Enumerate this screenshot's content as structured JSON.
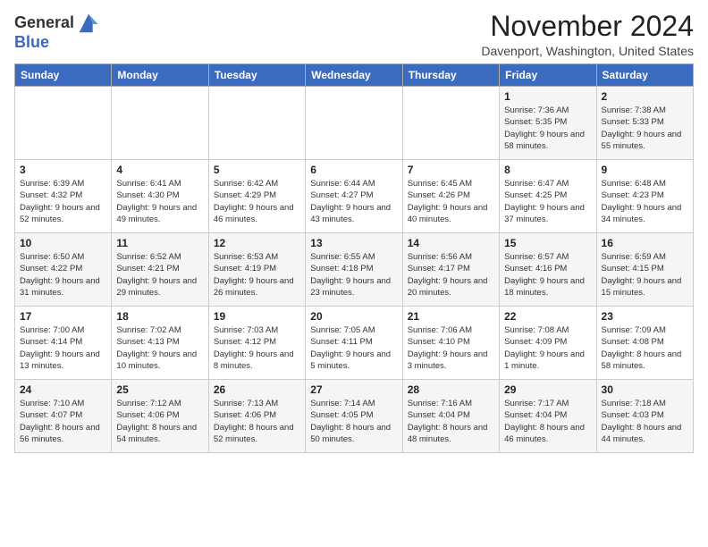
{
  "logo": {
    "line1": "General",
    "line2": "Blue"
  },
  "title": "November 2024",
  "location": "Davenport, Washington, United States",
  "days_of_week": [
    "Sunday",
    "Monday",
    "Tuesday",
    "Wednesday",
    "Thursday",
    "Friday",
    "Saturday"
  ],
  "weeks": [
    [
      {
        "day": "",
        "info": ""
      },
      {
        "day": "",
        "info": ""
      },
      {
        "day": "",
        "info": ""
      },
      {
        "day": "",
        "info": ""
      },
      {
        "day": "",
        "info": ""
      },
      {
        "day": "1",
        "info": "Sunrise: 7:36 AM\nSunset: 5:35 PM\nDaylight: 9 hours and 58 minutes."
      },
      {
        "day": "2",
        "info": "Sunrise: 7:38 AM\nSunset: 5:33 PM\nDaylight: 9 hours and 55 minutes."
      }
    ],
    [
      {
        "day": "3",
        "info": "Sunrise: 6:39 AM\nSunset: 4:32 PM\nDaylight: 9 hours and 52 minutes."
      },
      {
        "day": "4",
        "info": "Sunrise: 6:41 AM\nSunset: 4:30 PM\nDaylight: 9 hours and 49 minutes."
      },
      {
        "day": "5",
        "info": "Sunrise: 6:42 AM\nSunset: 4:29 PM\nDaylight: 9 hours and 46 minutes."
      },
      {
        "day": "6",
        "info": "Sunrise: 6:44 AM\nSunset: 4:27 PM\nDaylight: 9 hours and 43 minutes."
      },
      {
        "day": "7",
        "info": "Sunrise: 6:45 AM\nSunset: 4:26 PM\nDaylight: 9 hours and 40 minutes."
      },
      {
        "day": "8",
        "info": "Sunrise: 6:47 AM\nSunset: 4:25 PM\nDaylight: 9 hours and 37 minutes."
      },
      {
        "day": "9",
        "info": "Sunrise: 6:48 AM\nSunset: 4:23 PM\nDaylight: 9 hours and 34 minutes."
      }
    ],
    [
      {
        "day": "10",
        "info": "Sunrise: 6:50 AM\nSunset: 4:22 PM\nDaylight: 9 hours and 31 minutes."
      },
      {
        "day": "11",
        "info": "Sunrise: 6:52 AM\nSunset: 4:21 PM\nDaylight: 9 hours and 29 minutes."
      },
      {
        "day": "12",
        "info": "Sunrise: 6:53 AM\nSunset: 4:19 PM\nDaylight: 9 hours and 26 minutes."
      },
      {
        "day": "13",
        "info": "Sunrise: 6:55 AM\nSunset: 4:18 PM\nDaylight: 9 hours and 23 minutes."
      },
      {
        "day": "14",
        "info": "Sunrise: 6:56 AM\nSunset: 4:17 PM\nDaylight: 9 hours and 20 minutes."
      },
      {
        "day": "15",
        "info": "Sunrise: 6:57 AM\nSunset: 4:16 PM\nDaylight: 9 hours and 18 minutes."
      },
      {
        "day": "16",
        "info": "Sunrise: 6:59 AM\nSunset: 4:15 PM\nDaylight: 9 hours and 15 minutes."
      }
    ],
    [
      {
        "day": "17",
        "info": "Sunrise: 7:00 AM\nSunset: 4:14 PM\nDaylight: 9 hours and 13 minutes."
      },
      {
        "day": "18",
        "info": "Sunrise: 7:02 AM\nSunset: 4:13 PM\nDaylight: 9 hours and 10 minutes."
      },
      {
        "day": "19",
        "info": "Sunrise: 7:03 AM\nSunset: 4:12 PM\nDaylight: 9 hours and 8 minutes."
      },
      {
        "day": "20",
        "info": "Sunrise: 7:05 AM\nSunset: 4:11 PM\nDaylight: 9 hours and 5 minutes."
      },
      {
        "day": "21",
        "info": "Sunrise: 7:06 AM\nSunset: 4:10 PM\nDaylight: 9 hours and 3 minutes."
      },
      {
        "day": "22",
        "info": "Sunrise: 7:08 AM\nSunset: 4:09 PM\nDaylight: 9 hours and 1 minute."
      },
      {
        "day": "23",
        "info": "Sunrise: 7:09 AM\nSunset: 4:08 PM\nDaylight: 8 hours and 58 minutes."
      }
    ],
    [
      {
        "day": "24",
        "info": "Sunrise: 7:10 AM\nSunset: 4:07 PM\nDaylight: 8 hours and 56 minutes."
      },
      {
        "day": "25",
        "info": "Sunrise: 7:12 AM\nSunset: 4:06 PM\nDaylight: 8 hours and 54 minutes."
      },
      {
        "day": "26",
        "info": "Sunrise: 7:13 AM\nSunset: 4:06 PM\nDaylight: 8 hours and 52 minutes."
      },
      {
        "day": "27",
        "info": "Sunrise: 7:14 AM\nSunset: 4:05 PM\nDaylight: 8 hours and 50 minutes."
      },
      {
        "day": "28",
        "info": "Sunrise: 7:16 AM\nSunset: 4:04 PM\nDaylight: 8 hours and 48 minutes."
      },
      {
        "day": "29",
        "info": "Sunrise: 7:17 AM\nSunset: 4:04 PM\nDaylight: 8 hours and 46 minutes."
      },
      {
        "day": "30",
        "info": "Sunrise: 7:18 AM\nSunset: 4:03 PM\nDaylight: 8 hours and 44 minutes."
      }
    ]
  ]
}
